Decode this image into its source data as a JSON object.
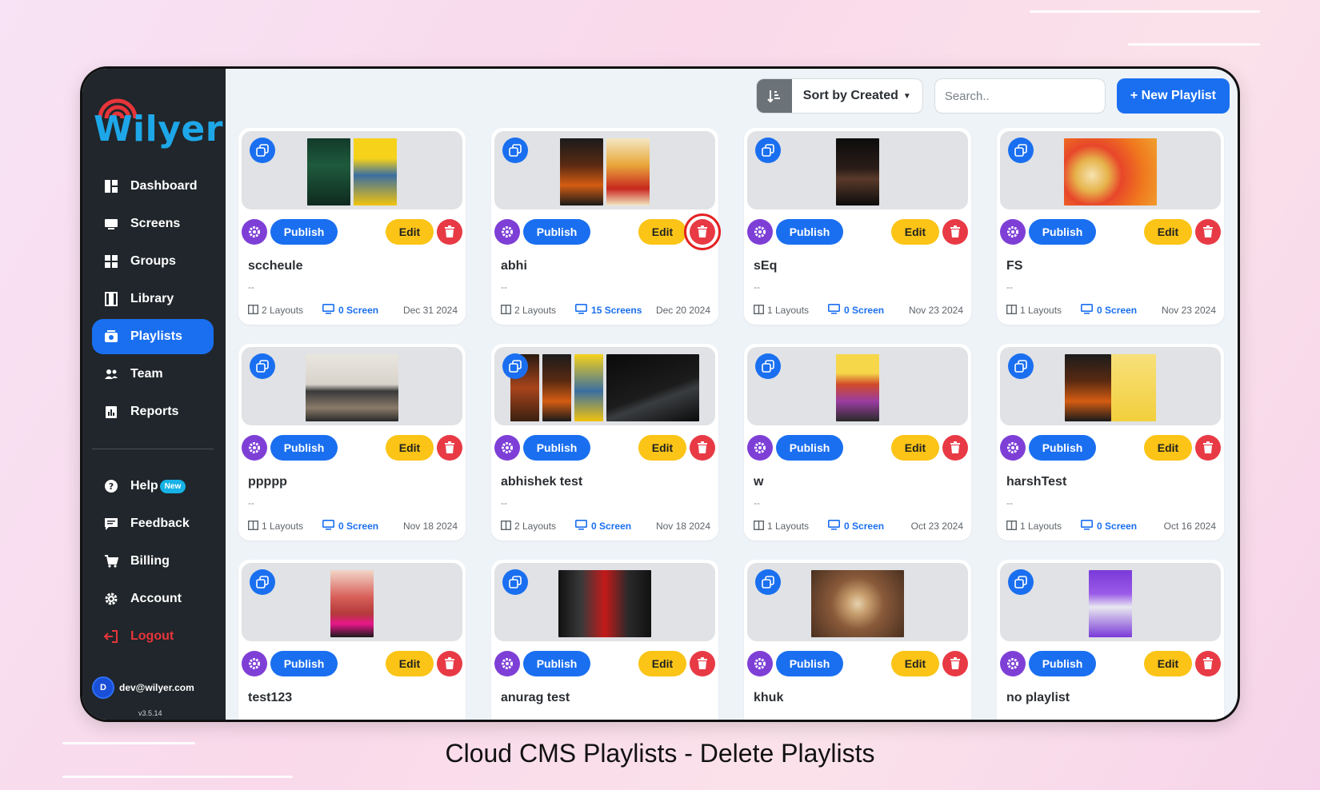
{
  "caption": "Cloud CMS Playlists - Delete Playlists",
  "brand": {
    "name": "Wilyer",
    "color": "#1ea7e8",
    "accent_arc": "#e8353a"
  },
  "sidebar": {
    "items": [
      {
        "label": "Dashboard",
        "icon": "dashboard-icon",
        "active": false
      },
      {
        "label": "Screens",
        "icon": "monitor-icon",
        "active": false
      },
      {
        "label": "Groups",
        "icon": "grid-icon",
        "active": false
      },
      {
        "label": "Library",
        "icon": "film-icon",
        "active": false
      },
      {
        "label": "Playlists",
        "icon": "playlist-icon",
        "active": true
      },
      {
        "label": "Team",
        "icon": "users-icon",
        "active": false
      },
      {
        "label": "Reports",
        "icon": "report-icon",
        "active": false
      }
    ],
    "secondary": [
      {
        "label": "Help",
        "icon": "help-icon",
        "badge": "New"
      },
      {
        "label": "Feedback",
        "icon": "feedback-icon"
      },
      {
        "label": "Billing",
        "icon": "cart-icon"
      },
      {
        "label": "Account",
        "icon": "gear-icon"
      },
      {
        "label": "Logout",
        "icon": "logout-icon"
      }
    ],
    "user": {
      "initial": "D",
      "email": "dev@wilyer.com"
    },
    "version": "v3.5.14"
  },
  "toolbar": {
    "sort_label": "Sort by Created",
    "search_placeholder": "Search..",
    "new_playlist_label": "+ New Playlist"
  },
  "card_labels": {
    "publish": "Publish",
    "edit": "Edit"
  },
  "playlists": [
    {
      "name": "sccheule",
      "desc": "--",
      "layouts": "2 Layouts",
      "screens": "0 Screen",
      "date": "Dec 31 2024"
    },
    {
      "name": "abhi",
      "desc": "--",
      "layouts": "2 Layouts",
      "screens": "15 Screens",
      "date": "Dec 20 2024"
    },
    {
      "name": "sEq",
      "desc": "--",
      "layouts": "1 Layouts",
      "screens": "0 Screen",
      "date": "Nov 23 2024"
    },
    {
      "name": "FS",
      "desc": "--",
      "layouts": "1 Layouts",
      "screens": "0 Screen",
      "date": "Nov 23 2024"
    },
    {
      "name": "ppppp",
      "desc": "--",
      "layouts": "1 Layouts",
      "screens": "0 Screen",
      "date": "Nov 18 2024"
    },
    {
      "name": "abhishek test",
      "desc": "--",
      "layouts": "2 Layouts",
      "screens": "0 Screen",
      "date": "Nov 18 2024"
    },
    {
      "name": "w",
      "desc": "--",
      "layouts": "1 Layouts",
      "screens": "0 Screen",
      "date": "Oct 23 2024"
    },
    {
      "name": "harshTest",
      "desc": "--",
      "layouts": "1 Layouts",
      "screens": "0 Screen",
      "date": "Oct 16 2024"
    },
    {
      "name": "test123",
      "desc": "--",
      "layouts": "",
      "screens": "",
      "date": ""
    },
    {
      "name": "anurag test",
      "desc": "--",
      "layouts": "",
      "screens": "",
      "date": ""
    },
    {
      "name": "khuk",
      "desc": "--",
      "layouts": "",
      "screens": "",
      "date": ""
    },
    {
      "name": "no playlist",
      "desc": "--",
      "layouts": "",
      "screens": "",
      "date": ""
    }
  ],
  "colors": {
    "primary": "#1a6ff0",
    "edit": "#fbc416",
    "delete": "#e83a45",
    "settings": "#7e3fd6",
    "highlight": "#e32222"
  }
}
